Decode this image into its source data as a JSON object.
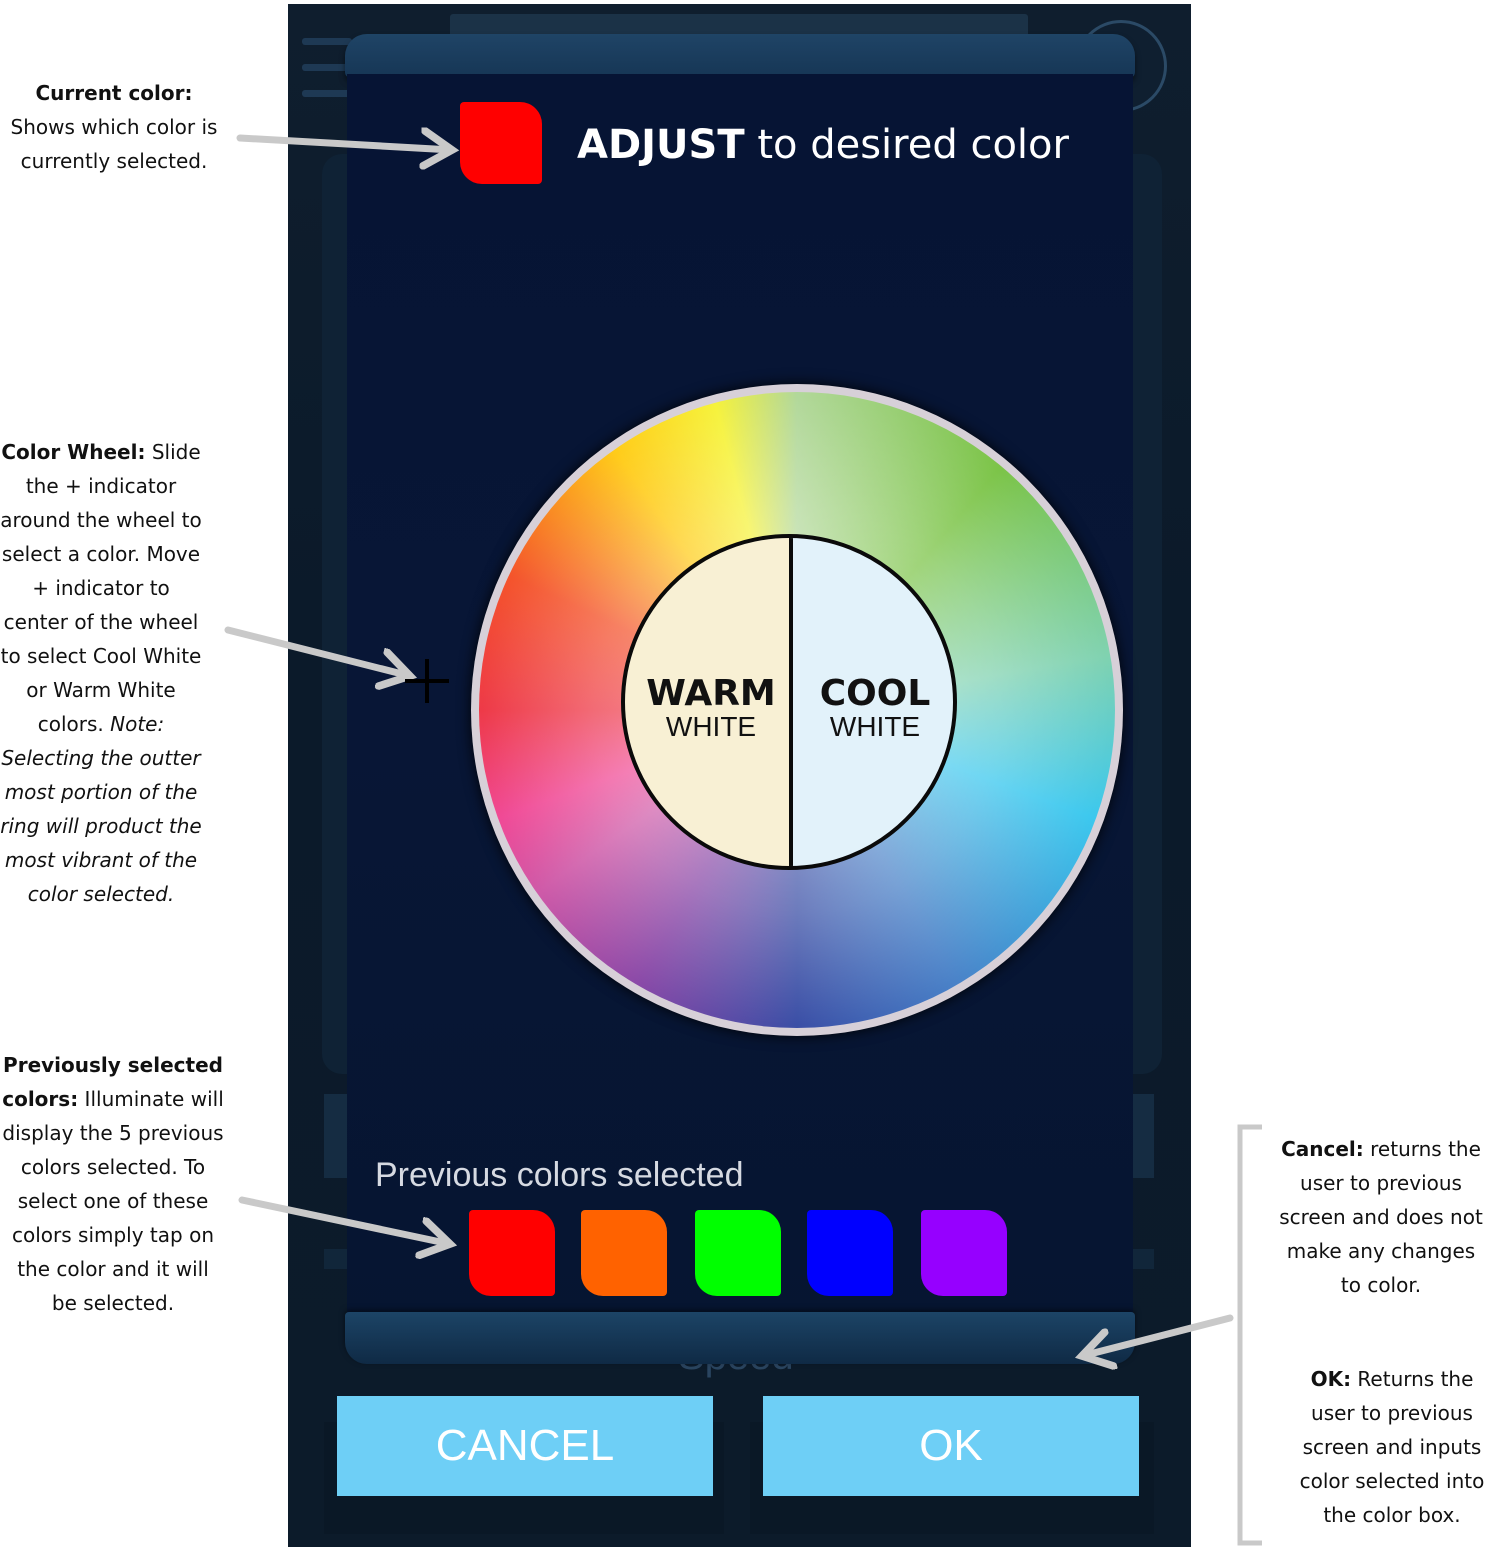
{
  "dialog": {
    "title_bold": "ADJUST",
    "title_rest": " to desired color",
    "current_color": "#ff0000",
    "warm_big": "WARM",
    "warm_small": "WHITE",
    "cool_big": "COOL",
    "cool_small": "WHITE",
    "previous_label": "Previous colors selected",
    "previous_colors": [
      "#ff0000",
      "#ff6200",
      "#00ff00",
      "#0000ff",
      "#9600ff"
    ]
  },
  "buttons": {
    "cancel": "CANCEL",
    "ok": "OK"
  },
  "background": {
    "speed_label": "Speed"
  },
  "annotations": {
    "current": {
      "title": "Current color:",
      "text": " Shows which color is currently selected."
    },
    "wheel": {
      "title": "Color Wheel:",
      "text": " Slide the + indicator around the wheel to select a color. Move + indicator to center of the wheel to select Cool White or Warm White colors.",
      "note": "Note: Selecting the outter most portion of the ring will product the most vibrant of the color selected."
    },
    "previous": {
      "title": "Previously selected colors:",
      "text": " Illuminate will display the 5 previous colors selected. To select one of these colors simply tap on the color and it will be selected."
    },
    "cancel": {
      "title": "Cancel:",
      "text": " returns the user to previous screen and does not make any changes to color."
    },
    "ok": {
      "title": "OK:",
      "text": " Returns the user to previous screen and inputs color selected into the color box."
    }
  }
}
